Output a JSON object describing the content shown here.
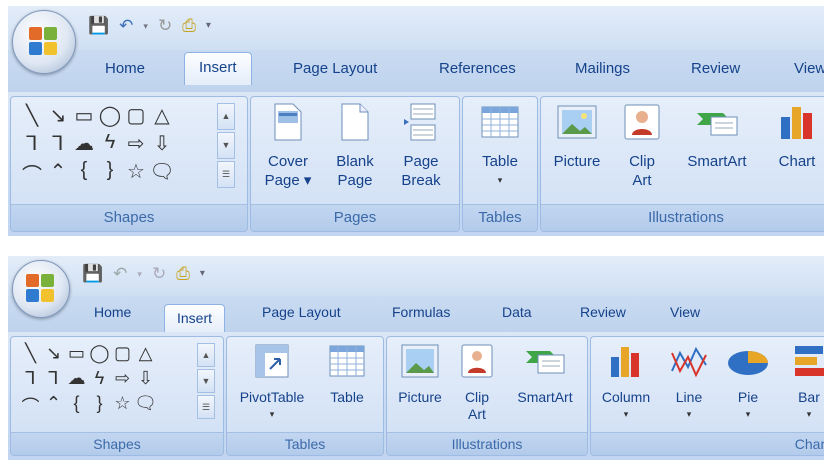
{
  "top": {
    "tabs": [
      "Home",
      "Insert",
      "Page Layout",
      "References",
      "Mailings",
      "Review",
      "View"
    ],
    "active_tab": "Insert",
    "groups": {
      "shapes": "Shapes",
      "pages": "Pages",
      "tables": "Tables",
      "illustrations": "Illustrations"
    },
    "buttons": {
      "cover_page": [
        "Cover",
        "Page"
      ],
      "blank_page": [
        "Blank",
        "Page"
      ],
      "page_break": [
        "Page",
        "Break"
      ],
      "table": "Table",
      "picture": "Picture",
      "clip_art": [
        "Clip",
        "Art"
      ],
      "smartart": "SmartArt",
      "chart": "Chart"
    }
  },
  "bottom": {
    "tabs": [
      "Home",
      "Insert",
      "Page Layout",
      "Formulas",
      "Data",
      "Review",
      "View"
    ],
    "active_tab": "Insert",
    "groups": {
      "shapes": "Shapes",
      "tables": "Tables",
      "illustrations": "Illustrations",
      "charts": "Chart"
    },
    "buttons": {
      "pivot_table": "PivotTable",
      "table": "Table",
      "picture": "Picture",
      "clip_art": [
        "Clip",
        "Art"
      ],
      "smartart": "SmartArt",
      "column": "Column",
      "line": "Line",
      "pie": "Pie",
      "bar": "Bar"
    }
  },
  "icons": {
    "office_button": "office-logo-icon",
    "save": "save-icon",
    "undo": "undo-icon",
    "redo": "redo-icon",
    "customize": "customize-qat-icon"
  },
  "colors": {
    "ribbon_bg": "#c7daf3",
    "tab_text": "#15428b",
    "group_label": "#3c6aa8",
    "border": "#8db2e3"
  }
}
